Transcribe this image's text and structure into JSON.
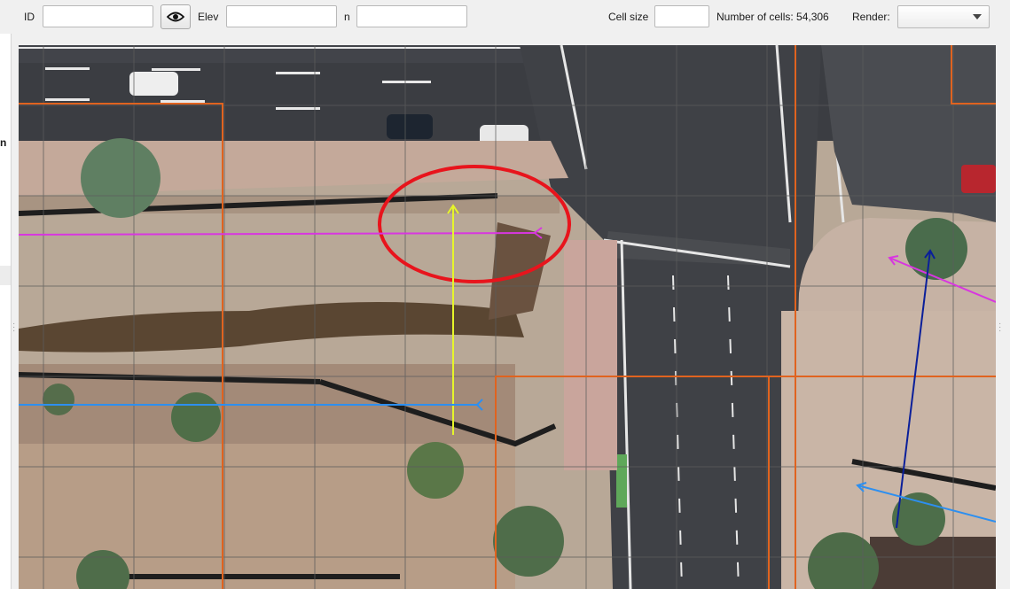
{
  "toolbar": {
    "id_label": "ID",
    "id_value": "",
    "eye_icon": "eye-icon",
    "elev_label": "Elev",
    "elev_value": "",
    "n_label": "n",
    "n_value": "",
    "cell_size_label": "Cell size",
    "cell_size_value": "",
    "num_cells_label": "Number of cells: 54,306",
    "render_label": "Render:",
    "render_value": ""
  },
  "side_panel": {
    "fragment_text": "n"
  },
  "map": {
    "description_colors": {
      "grid_line": "#6e6e6e",
      "cell_boundary": "#e0631f",
      "highlight_ellipse": "#e8141c",
      "arrow_magenta": "#d836e0",
      "arrow_yellow": "#e6f52a",
      "arrow_blue": "#2d8ff0",
      "arrow_navy": "#0a1f9a"
    }
  }
}
